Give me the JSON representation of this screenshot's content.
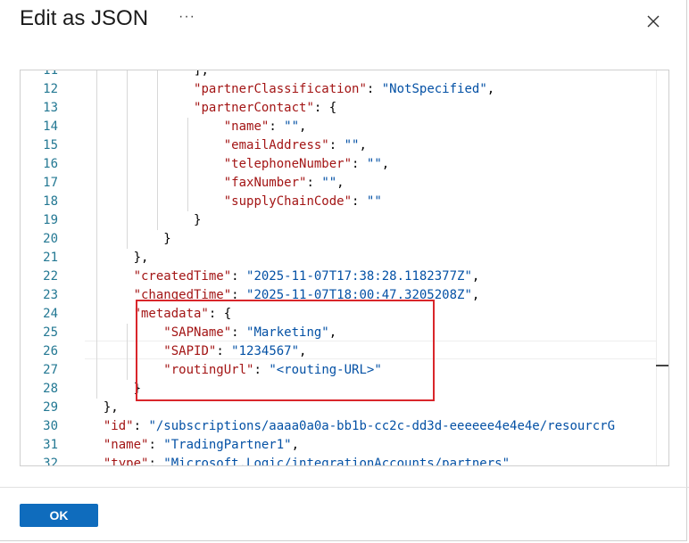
{
  "dialog": {
    "title": "Edit as JSON",
    "more_label": "···"
  },
  "editor": {
    "lines": [
      {
        "n": "11",
        "indent": 7,
        "tokens": [
          {
            "t": "p",
            "v": "],"
          }
        ]
      },
      {
        "n": "12",
        "indent": 7,
        "tokens": [
          {
            "t": "k",
            "v": "\"partnerClassification\""
          },
          {
            "t": "p",
            "v": ": "
          },
          {
            "t": "s",
            "v": "\"NotSpecified\""
          },
          {
            "t": "p",
            "v": ","
          }
        ]
      },
      {
        "n": "13",
        "indent": 7,
        "tokens": [
          {
            "t": "k",
            "v": "\"partnerContact\""
          },
          {
            "t": "p",
            "v": ": {"
          }
        ]
      },
      {
        "n": "14",
        "indent": 9,
        "tokens": [
          {
            "t": "k",
            "v": "\"name\""
          },
          {
            "t": "p",
            "v": ": "
          },
          {
            "t": "s",
            "v": "\"\""
          },
          {
            "t": "p",
            "v": ","
          }
        ]
      },
      {
        "n": "15",
        "indent": 9,
        "tokens": [
          {
            "t": "k",
            "v": "\"emailAddress\""
          },
          {
            "t": "p",
            "v": ": "
          },
          {
            "t": "s",
            "v": "\"\""
          },
          {
            "t": "p",
            "v": ","
          }
        ]
      },
      {
        "n": "16",
        "indent": 9,
        "tokens": [
          {
            "t": "k",
            "v": "\"telephoneNumber\""
          },
          {
            "t": "p",
            "v": ": "
          },
          {
            "t": "s",
            "v": "\"\""
          },
          {
            "t": "p",
            "v": ","
          }
        ]
      },
      {
        "n": "17",
        "indent": 9,
        "tokens": [
          {
            "t": "k",
            "v": "\"faxNumber\""
          },
          {
            "t": "p",
            "v": ": "
          },
          {
            "t": "s",
            "v": "\"\""
          },
          {
            "t": "p",
            "v": ","
          }
        ]
      },
      {
        "n": "18",
        "indent": 9,
        "tokens": [
          {
            "t": "k",
            "v": "\"supplyChainCode\""
          },
          {
            "t": "p",
            "v": ": "
          },
          {
            "t": "s",
            "v": "\"\""
          }
        ]
      },
      {
        "n": "19",
        "indent": 7,
        "tokens": [
          {
            "t": "p",
            "v": "}"
          }
        ]
      },
      {
        "n": "20",
        "indent": 5,
        "tokens": [
          {
            "t": "p",
            "v": "}"
          }
        ]
      },
      {
        "n": "21",
        "indent": 3,
        "tokens": [
          {
            "t": "p",
            "v": "},"
          }
        ]
      },
      {
        "n": "22",
        "indent": 3,
        "tokens": [
          {
            "t": "k",
            "v": "\"createdTime\""
          },
          {
            "t": "p",
            "v": ": "
          },
          {
            "t": "s",
            "v": "\"2025-11-07T17:38:28.1182377Z\""
          },
          {
            "t": "p",
            "v": ","
          }
        ]
      },
      {
        "n": "23",
        "indent": 3,
        "tokens": [
          {
            "t": "k",
            "v": "\"changedTime\""
          },
          {
            "t": "p",
            "v": ": "
          },
          {
            "t": "s",
            "v": "\"2025-11-07T18:00:47.3205208Z\""
          },
          {
            "t": "p",
            "v": ","
          }
        ]
      },
      {
        "n": "24",
        "indent": 3,
        "tokens": [
          {
            "t": "k",
            "v": "\"metadata\""
          },
          {
            "t": "p",
            "v": ": {"
          }
        ]
      },
      {
        "n": "25",
        "indent": 5,
        "tokens": [
          {
            "t": "k",
            "v": "\"SAPName\""
          },
          {
            "t": "p",
            "v": ": "
          },
          {
            "t": "s",
            "v": "\"Marketing\""
          },
          {
            "t": "p",
            "v": ","
          }
        ]
      },
      {
        "n": "26",
        "indent": 5,
        "tokens": [
          {
            "t": "k",
            "v": "\"SAPID\""
          },
          {
            "t": "p",
            "v": ": "
          },
          {
            "t": "s",
            "v": "\"1234567\""
          },
          {
            "t": "p",
            "v": ","
          }
        ]
      },
      {
        "n": "27",
        "indent": 5,
        "tokens": [
          {
            "t": "k",
            "v": "\"routingUrl\""
          },
          {
            "t": "p",
            "v": ": "
          },
          {
            "t": "s",
            "v": "\"<routing-URL>\""
          }
        ]
      },
      {
        "n": "28",
        "indent": 3,
        "tokens": [
          {
            "t": "p",
            "v": "}"
          }
        ]
      },
      {
        "n": "29",
        "indent": 1,
        "tokens": [
          {
            "t": "p",
            "v": "},"
          }
        ]
      },
      {
        "n": "30",
        "indent": 1,
        "tokens": [
          {
            "t": "k",
            "v": "\"id\""
          },
          {
            "t": "p",
            "v": ": "
          },
          {
            "t": "s",
            "v": "\"/subscriptions/aaaa0a0a-bb1b-cc2c-dd3d-eeeeee4e4e4e/resourcrG"
          }
        ]
      },
      {
        "n": "31",
        "indent": 1,
        "tokens": [
          {
            "t": "k",
            "v": "\"name\""
          },
          {
            "t": "p",
            "v": ": "
          },
          {
            "t": "s",
            "v": "\"TradingPartner1\""
          },
          {
            "t": "p",
            "v": ","
          }
        ]
      },
      {
        "n": "32",
        "indent": 1,
        "tokens": [
          {
            "t": "k",
            "v": "\"type\""
          },
          {
            "t": "p",
            "v": ": "
          },
          {
            "t": "s",
            "v": "\"Microsoft.Logic/integrationAccounts/partners\""
          }
        ]
      }
    ]
  },
  "footer": {
    "ok_label": "OK"
  }
}
